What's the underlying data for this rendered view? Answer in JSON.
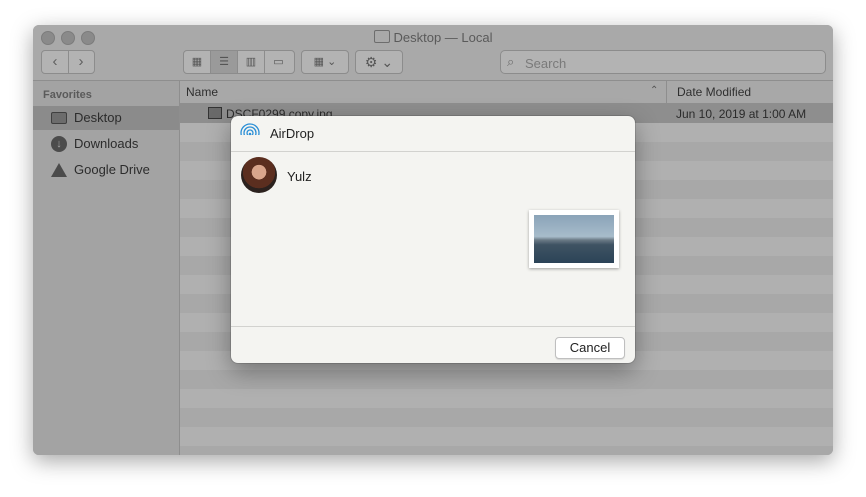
{
  "window": {
    "title": "Desktop — Local"
  },
  "toolbar": {
    "back": "‹",
    "forward": "›",
    "view_icon": "▦",
    "list_icon": "☰",
    "column_icon": "▥",
    "gallery_icon": "▭",
    "group_icon": "▦ ⌄",
    "action_icon": "⚙ ⌄",
    "search_icon": "🔍",
    "search_placeholder": "Search"
  },
  "sidebar": {
    "section_title": "Favorites",
    "items": [
      {
        "label": "Desktop",
        "icon": "desktop-icon",
        "selected": true
      },
      {
        "label": "Downloads",
        "icon": "downloads-icon",
        "selected": false
      },
      {
        "label": "Google Drive",
        "icon": "google-drive-icon",
        "selected": false
      }
    ]
  },
  "columns": {
    "name": "Name",
    "date": "Date Modified",
    "sort_indicator": "⌃"
  },
  "files": [
    {
      "name": "DSCF0299 copy.jpg",
      "date": "Jun 10, 2019 at 1:00 AM"
    }
  ],
  "airdrop": {
    "title": "AirDrop",
    "recipient": "Yulz",
    "cancel_label": "Cancel"
  },
  "colors": {
    "dialog_bg": "#f4f4f1",
    "airdrop_blue": "#2b8fd6",
    "dimmed_window": "#a8a8a8"
  }
}
